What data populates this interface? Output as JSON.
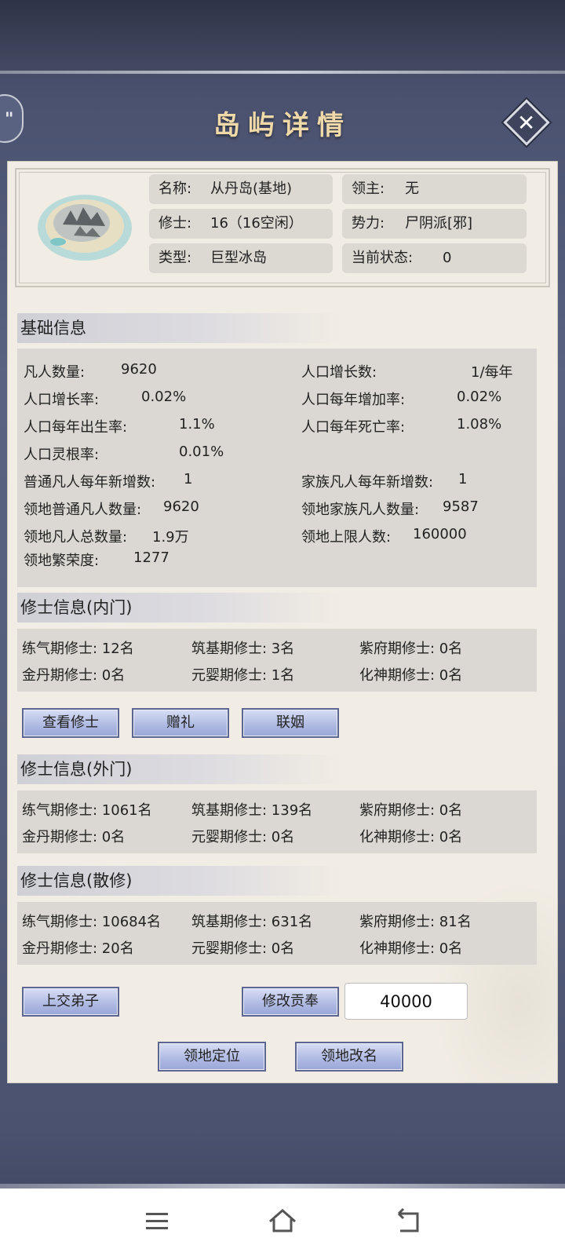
{
  "title": "岛屿详情",
  "island": {
    "name_key": "名称:",
    "name_val": "从丹岛(基地)",
    "lord_key": "领主:",
    "lord_val": "无",
    "cult_key": "修士:",
    "cult_val": "16（16空闲）",
    "force_key": "势力:",
    "force_val": "尸阴派[邪]",
    "type_key": "类型:",
    "type_val": "巨型冰岛",
    "status_key": "当前状态:",
    "status_val": "0"
  },
  "basic": {
    "heading": "基础信息",
    "rows": [
      {
        "k": "凡人数量:",
        "v": "9620"
      },
      {
        "k": "人口增长数:",
        "v": "1/每年"
      },
      {
        "k": "人口增长率:",
        "v": "0.02%"
      },
      {
        "k": "人口每年增加率:",
        "v": "0.02%"
      },
      {
        "k": "人口每年出生率:",
        "v": "1.1%"
      },
      {
        "k": "人口每年死亡率:",
        "v": "1.08%"
      },
      {
        "k": "人口灵根率:",
        "v": "0.01%"
      },
      {
        "k": "普通凡人每年新增数:",
        "v": "1"
      },
      {
        "k": "家族凡人每年新增数:",
        "v": "1"
      },
      {
        "k": "领地普通凡人数量:",
        "v": "9620"
      },
      {
        "k": "领地家族凡人数量:",
        "v": "9587"
      },
      {
        "k": "领地凡人总数量:",
        "v": "1.9万"
      },
      {
        "k": "领地上限人数:",
        "v": "160000"
      },
      {
        "k": "领地繁荣度:",
        "v": "1277"
      }
    ]
  },
  "inner": {
    "heading": "修士信息(内门)",
    "cells": [
      "练气期修士: 12名",
      "筑基期修士: 3名",
      "紫府期修士: 0名",
      "金丹期修士: 0名",
      "元婴期修士: 1名",
      "化神期修士: 0名"
    ],
    "buttons": [
      "查看修士",
      "赠礼",
      "联姻"
    ]
  },
  "outer": {
    "heading": "修士信息(外门)",
    "cells": [
      "练气期修士: 1061名",
      "筑基期修士: 139名",
      "紫府期修士: 0名",
      "金丹期修士: 0名",
      "元婴期修士: 0名",
      "化神期修士: 0名"
    ]
  },
  "loose": {
    "heading": "修士信息(散修)",
    "cells": [
      "练气期修士: 10684名",
      "筑基期修士: 631名",
      "紫府期修士: 81名",
      "金丹期修士: 20名",
      "元婴期修士: 0名",
      "化神期修士: 0名"
    ]
  },
  "actions": {
    "submit_disciple": "上交弟子",
    "modify_tribute": "修改贡奉",
    "tribute_value": "40000",
    "locate": "领地定位",
    "rename": "领地改名"
  },
  "icons": {
    "close": "close-icon",
    "menu": "menu-icon",
    "home": "home-icon",
    "back": "back-icon"
  },
  "colors": {
    "title": "#f0d9a8",
    "button": "#aeb9e2",
    "panel": "#f2ede4"
  }
}
